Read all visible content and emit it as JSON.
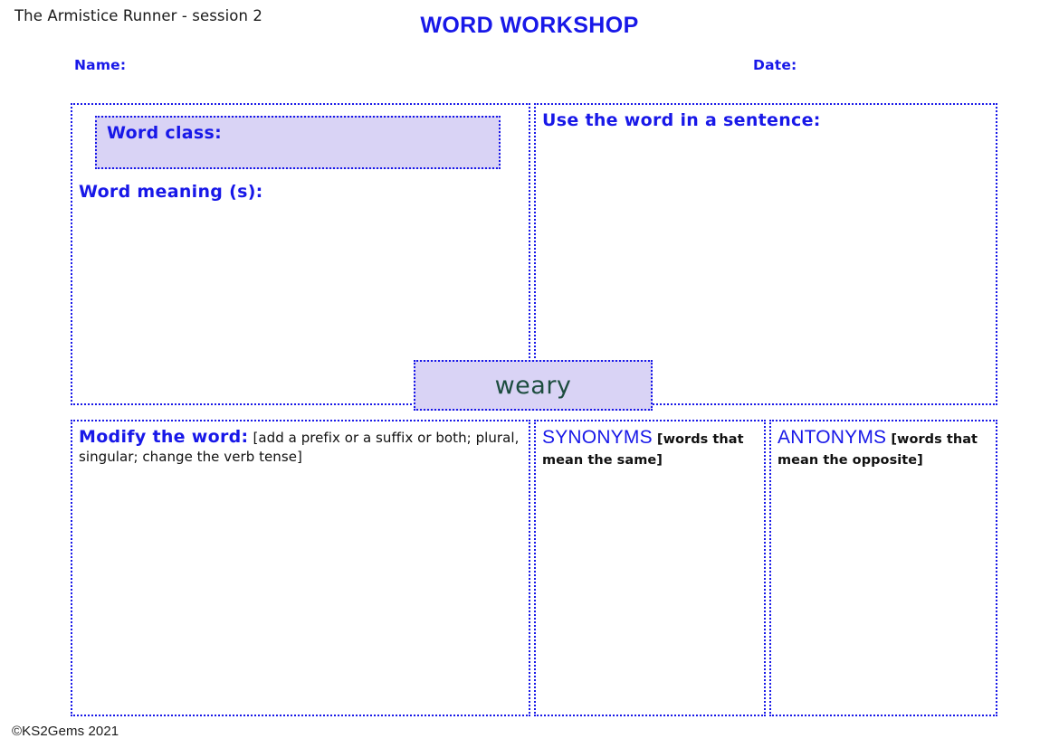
{
  "header": {
    "session_label": "The Armistice Runner - session 2",
    "title": "WORD WORKSHOP",
    "name_label": "Name:",
    "date_label": "Date:"
  },
  "word": {
    "target_word": "weary",
    "chip_bg": "#d9d3f5",
    "chip_text_color": "#1d4d3f"
  },
  "panels": {
    "word_info": {
      "word_class_label": "Word class:",
      "word_meaning_label": "Word meaning (s):"
    },
    "sentence": {
      "label": "Use the word in a sentence:"
    },
    "modify": {
      "label": "Modify the word:",
      "note": "[add a prefix or a suffix or both; plural, singular; change the verb tense]"
    },
    "synonyms": {
      "label": "SYNONYMS",
      "note": "[words that mean the same]"
    },
    "antonyms": {
      "label": "ANTONYMS",
      "note": "[words that mean the opposite]"
    }
  },
  "footer": {
    "copyright": "©KS2Gems 2021"
  },
  "theme": {
    "accent_blue": "#1818e8",
    "panel_fill": "#d9d3f5",
    "page_bg": "#ffffff",
    "body_text": "#111111"
  }
}
